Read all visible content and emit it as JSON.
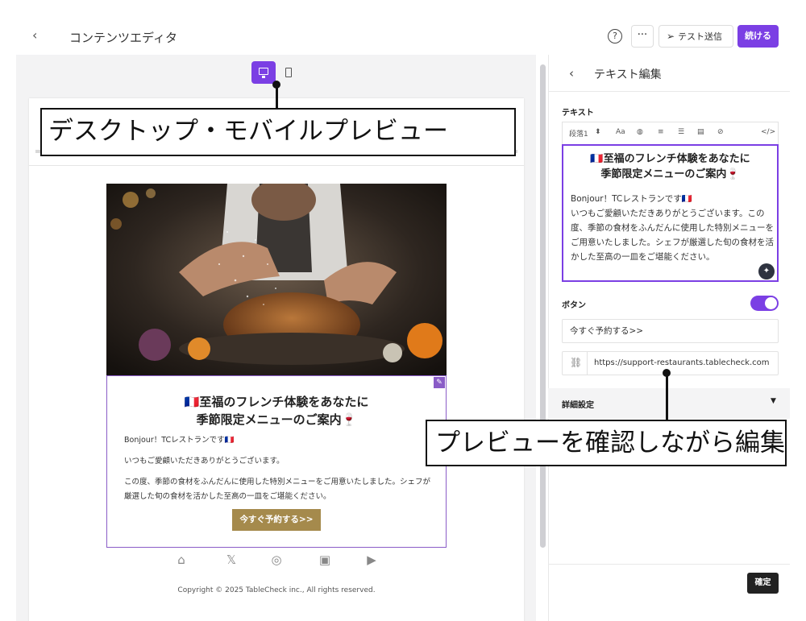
{
  "header": {
    "back_icon": "‹",
    "title": "コンテンツエディタ",
    "help_icon": "?",
    "more_icon": "···",
    "test_send_label": "テスト送信",
    "continue_label": "続ける"
  },
  "email_preview": {
    "title_line1": "🇫🇷至福のフレンチ体験をあなたに",
    "title_line2": "季節限定メニューのご案内🍷",
    "body": [
      "Bonjour！TCレストランです🇫🇷",
      "いつもご愛顧いただきありがとうございます。",
      "この度、季節の食材をふんだんに使用した特別メニューをご用意いたしました。シェフが厳選した旬の食材を活かした至高の一皿をご堪能ください。"
    ],
    "button_label": "今すぐ予約する>>",
    "copyright": "Copyright © 2025 TableCheck inc., All rights reserved."
  },
  "panel": {
    "back_icon": "‹",
    "title": "テキスト編集",
    "text_label": "テキスト",
    "toolbar": {
      "paragraph": "段落1",
      "font_size_icon": "Aa",
      "code_icon": "</>"
    },
    "editor_title_line1": "🇫🇷至福のフレンチ体験をあなたに",
    "editor_title_line2": "季節限定メニューのご案内🍷",
    "editor_body": "Bonjour！TCレストランです🇫🇷\nいつもご愛顧いただきありがとうございます。この度、季節の食材をふんだんに使用した特別メニューをご用意いたしました。シェフが厳選した旬の食材を活かした至高の一皿をご堪能ください。",
    "button_label": "ボタン",
    "button_text": "今すぐ予約する>>",
    "button_url": "https://support-restaurants.tablecheck.com",
    "advanced_label": "詳細設定",
    "confirm_label": "確定"
  },
  "callouts": {
    "device_preview": "デスクトップ・モバイルプレビュー",
    "edit_while_preview": "プレビューを確認しながら編集"
  },
  "colors": {
    "accent": "#7b3fe4",
    "button_gold": "#a58a4c"
  }
}
